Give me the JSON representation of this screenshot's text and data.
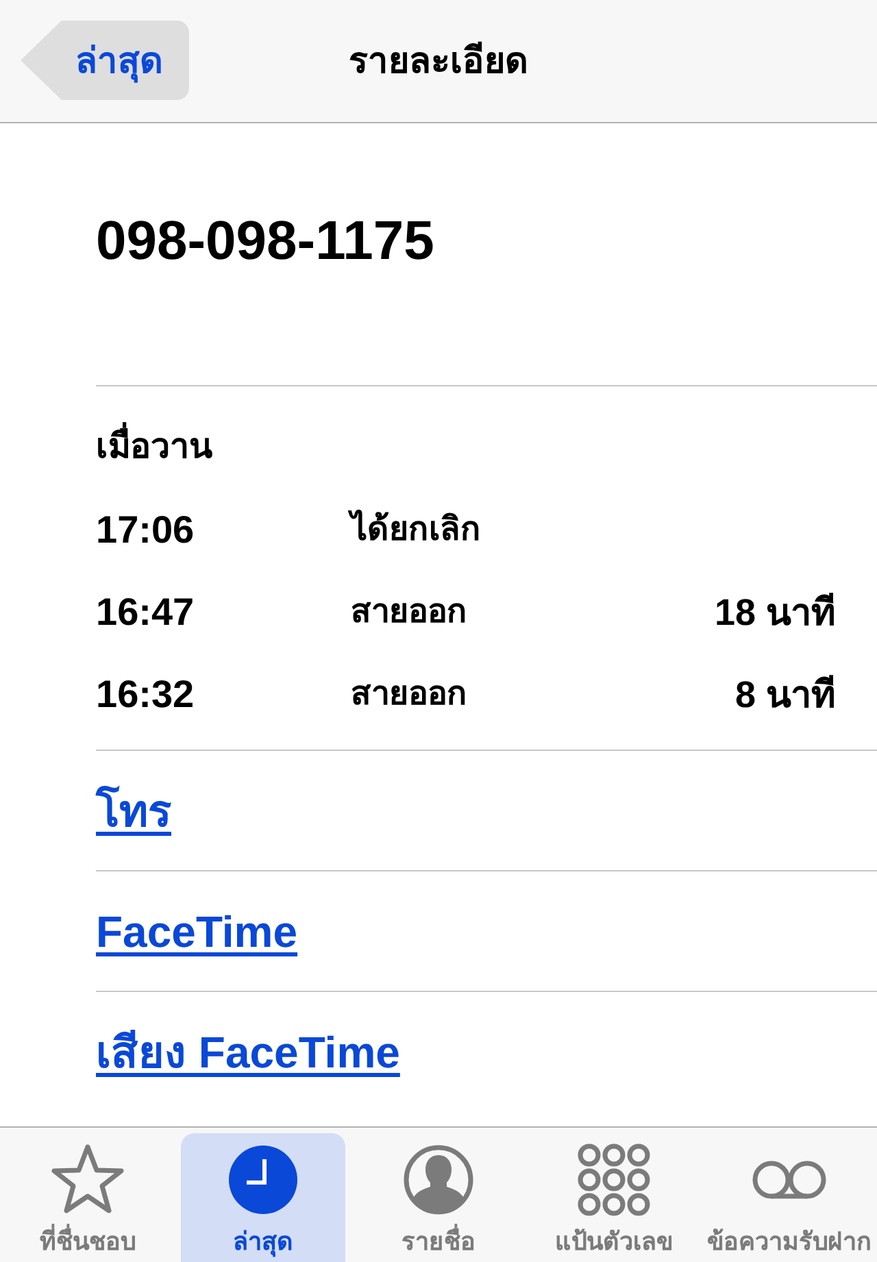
{
  "nav_bar": {
    "back_button": "ล่าสุด",
    "title": "รายละเอียด"
  },
  "contact": {
    "phone_number": "098-098-1175"
  },
  "recents": {
    "day": "เมื่อวาน",
    "calls": [
      {
        "time": "17:06",
        "type": "ได้ยกเลิก"
      },
      {
        "time": "16:47",
        "type": "สายออก",
        "duration": "18 นาที"
      },
      {
        "time": "16:32",
        "type": "สายออก",
        "duration": "8 นาที"
      }
    ]
  },
  "actions": [
    "โทร",
    "FaceTime",
    "เสียง FaceTime"
  ],
  "tab_bar": [
    {
      "kind": "favorites",
      "label": "ที่ชื่นชอบ",
      "selected": false
    },
    {
      "kind": "recents",
      "label": "ล่าสุด",
      "selected": true
    },
    {
      "kind": "contacts",
      "label": "รายชื่อ",
      "selected": false
    },
    {
      "kind": "keypad",
      "label": "แป้นตัวเลข",
      "selected": false
    },
    {
      "kind": "voicemail",
      "label": "ข้อความรับฝาก",
      "selected": false
    }
  ]
}
